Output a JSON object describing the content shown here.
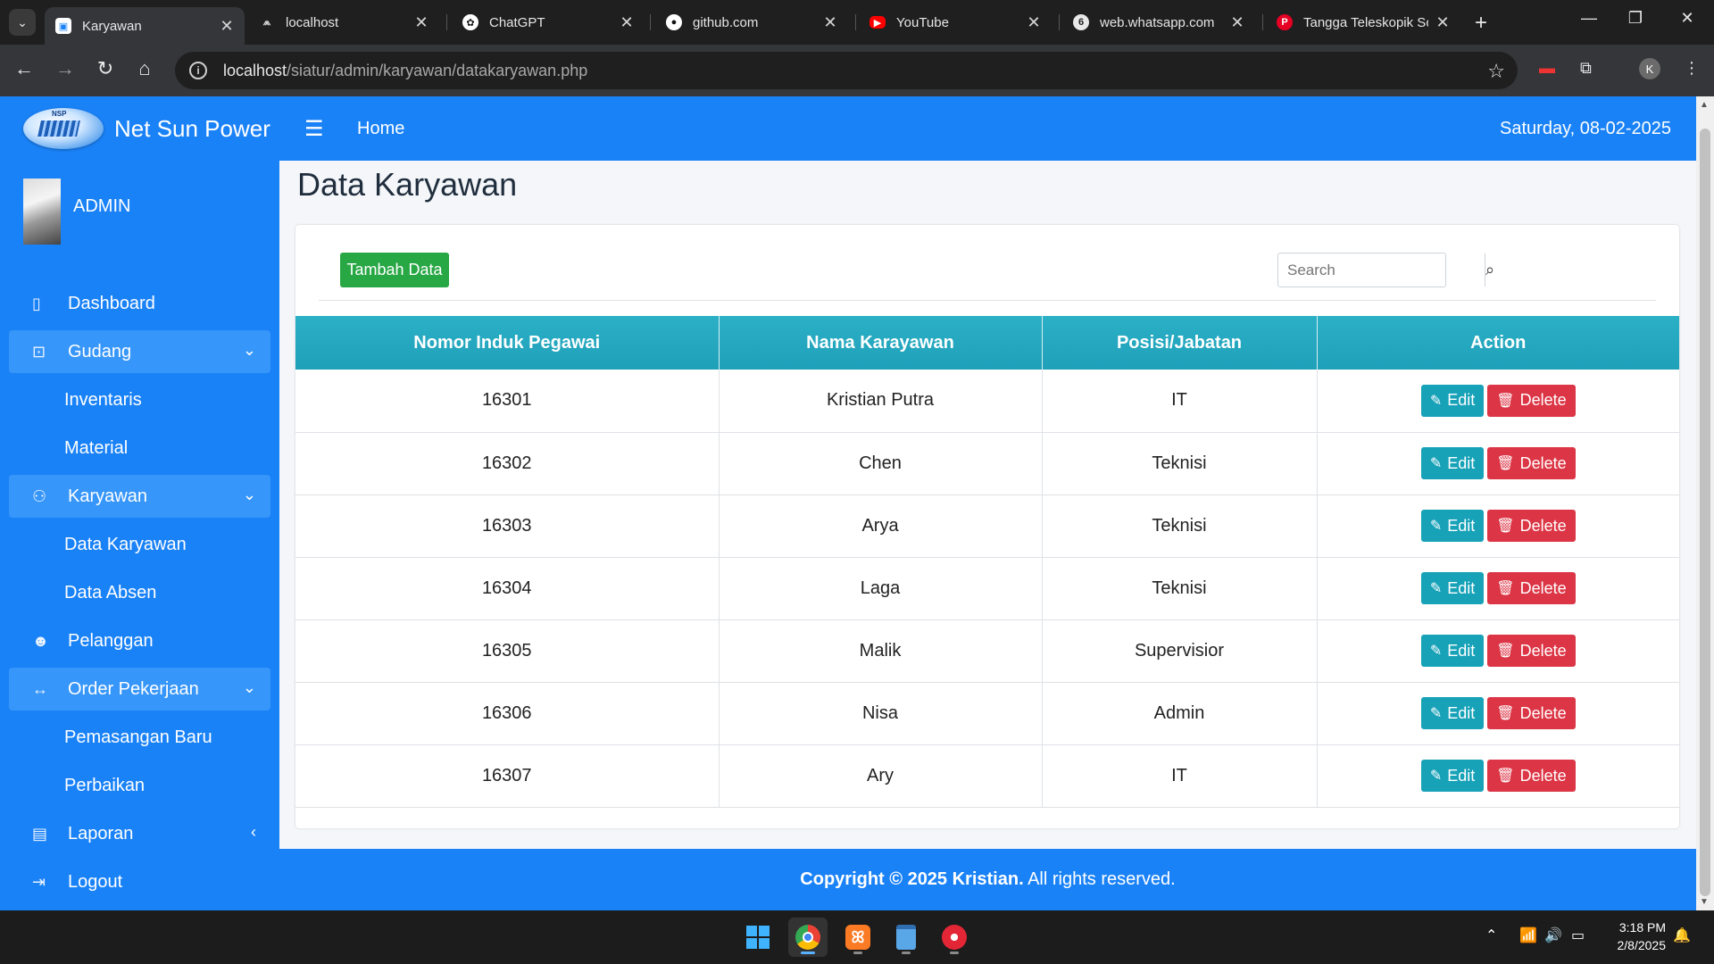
{
  "browser": {
    "tabs": [
      {
        "title": "Karyawan",
        "icon": "page-icon",
        "active": true
      },
      {
        "title": "localhost",
        "icon": "xampp-icon",
        "active": false
      },
      {
        "title": "ChatGPT",
        "icon": "chatgpt-icon",
        "active": false
      },
      {
        "title": "github.com",
        "icon": "github-icon",
        "active": false
      },
      {
        "title": "YouTube",
        "icon": "youtube-icon",
        "active": false
      },
      {
        "title": "web.whatsapp.com",
        "icon": "whatsapp-icon",
        "active": false
      },
      {
        "title": "Tangga Teleskopik Sc",
        "icon": "pinterest-icon",
        "active": false
      }
    ],
    "url_host": "localhost",
    "url_path": "/siatur/admin/karyawan/datakaryawan.php",
    "profile_initial": "K"
  },
  "brand": {
    "name": "Net Sun Power",
    "logo_text": "NSP"
  },
  "user": {
    "name": "ADMIN"
  },
  "sidebar": {
    "items": [
      {
        "label": "Dashboard",
        "icon": "clipboard-icon"
      },
      {
        "label": "Gudang",
        "icon": "warehouse-icon"
      },
      {
        "label": "Inventaris"
      },
      {
        "label": "Material"
      },
      {
        "label": "Karyawan",
        "icon": "users-icon"
      },
      {
        "label": "Data Karyawan"
      },
      {
        "label": "Data Absen"
      },
      {
        "label": "Pelanggan",
        "icon": "customer-icon"
      },
      {
        "label": "Order Pekerjaan",
        "icon": "exchange-icon"
      },
      {
        "label": "Pemasangan Baru"
      },
      {
        "label": "Perbaikan"
      },
      {
        "label": "Laporan",
        "icon": "file-icon"
      },
      {
        "label": "Logout",
        "icon": "logout-icon"
      }
    ]
  },
  "topnav": {
    "home": "Home",
    "date": "Saturday, 08-02-2025"
  },
  "page": {
    "title": "Data Karyawan"
  },
  "toolbar": {
    "add_label": "Tambah Data",
    "search_placeholder": "Search"
  },
  "table": {
    "headers": [
      "Nomor Induk Pegawai",
      "Nama Karayawan",
      "Posisi/Jabatan",
      "Action"
    ],
    "edit_label": "Edit",
    "delete_label": "Delete",
    "rows": [
      {
        "nip": "16301",
        "nama": "Kristian Putra",
        "posisi": "IT"
      },
      {
        "nip": "16302",
        "nama": "Chen",
        "posisi": "Teknisi"
      },
      {
        "nip": "16303",
        "nama": "Arya",
        "posisi": "Teknisi"
      },
      {
        "nip": "16304",
        "nama": "Laga",
        "posisi": "Teknisi"
      },
      {
        "nip": "16305",
        "nama": "Malik",
        "posisi": "Supervisior"
      },
      {
        "nip": "16306",
        "nama": "Nisa",
        "posisi": "Admin"
      },
      {
        "nip": "16307",
        "nama": "Ary",
        "posisi": "IT"
      }
    ]
  },
  "footer": {
    "bold": "Copyright © 2025 Kristian.",
    "rest": " All rights reserved."
  },
  "taskbar": {
    "time": "3:18 PM",
    "date": "2/8/2025"
  },
  "colors": {
    "primary": "#1a82f7",
    "table_header": "#1fa0b9",
    "success": "#28a745",
    "info": "#17a2b8",
    "danger": "#dc3545"
  }
}
